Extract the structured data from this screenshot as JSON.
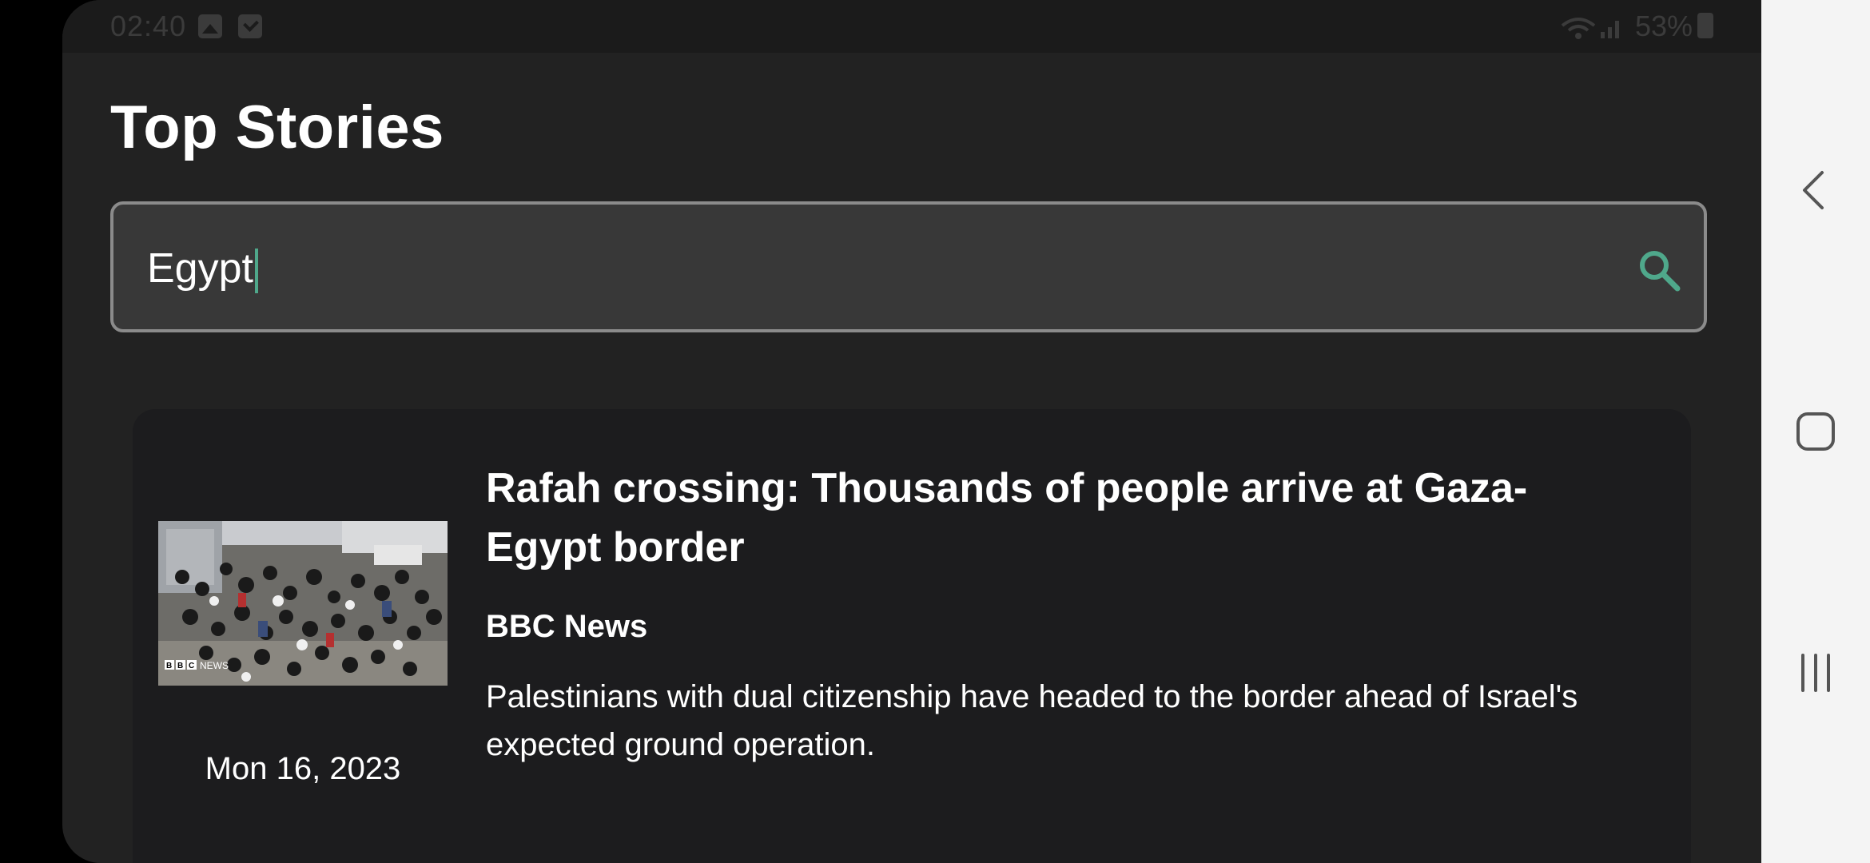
{
  "status_bar": {
    "time": "02:40",
    "battery": "53%"
  },
  "page": {
    "title": "Top Stories"
  },
  "search": {
    "value": "Egypt"
  },
  "articles": [
    {
      "headline": "Rafah crossing: Thousands of people arrive at Gaza-Egypt border",
      "source": "BBC News",
      "description": "Palestinians with dual citizenship have headed to the border ahead of Israel's expected ground operation.",
      "date": "Mon 16, 2023",
      "thumbnail_watermark": "BBC NEWS"
    }
  ],
  "icons": {
    "search": "search-icon",
    "back": "back-icon",
    "home": "home-icon",
    "recents": "recents-icon"
  },
  "colors": {
    "accent": "#4fa88b",
    "app_background": "#222222",
    "card_background": "#1c1c1e",
    "search_background": "#383838",
    "search_border": "#8b8b8b",
    "nav_bar": "#f4f4f4"
  }
}
